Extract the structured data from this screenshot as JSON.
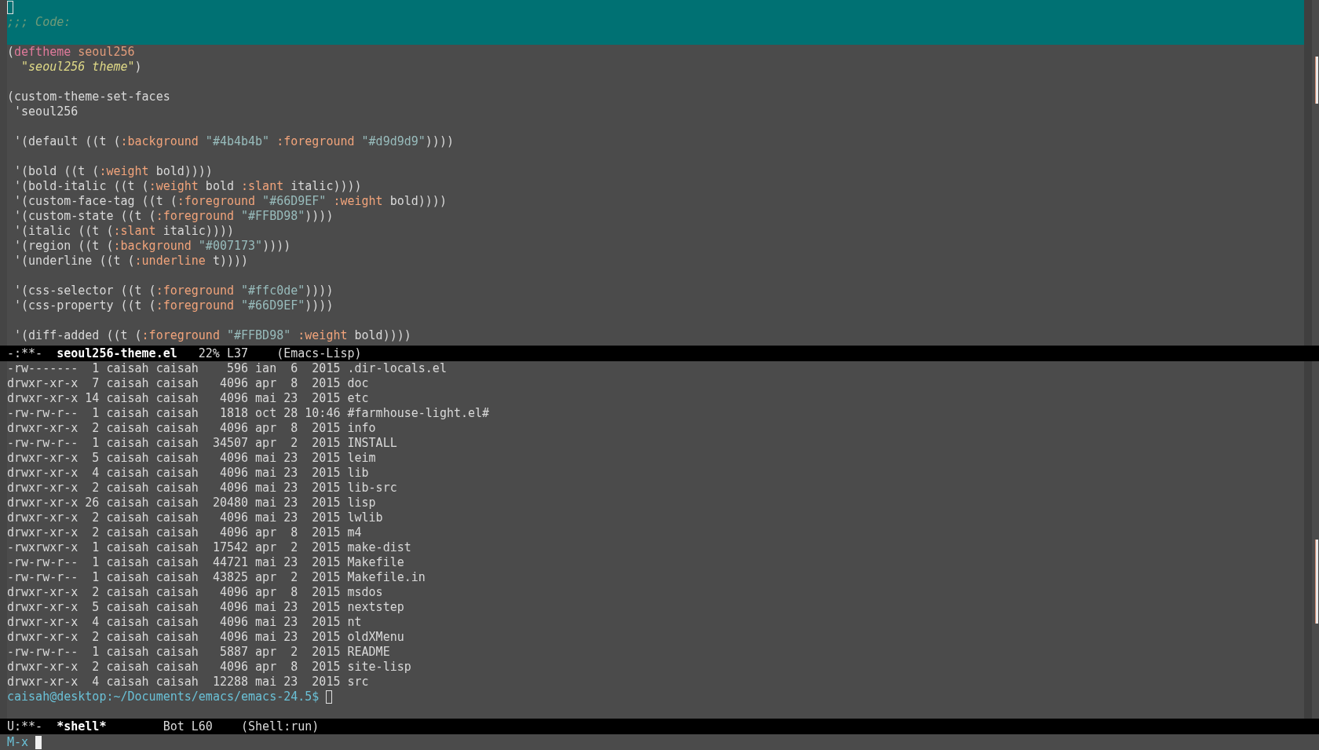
{
  "code_window": {
    "region_lines": [
      {
        "kind": "cursor"
      },
      {
        "kind": "text",
        "tokens": [
          {
            "kind": "comment",
            "text": ";;; Code:"
          }
        ]
      },
      {
        "kind": "blank"
      }
    ],
    "lines": [
      {
        "kind": "text",
        "tokens": [
          "(",
          {
            "kind": "keyword",
            "text": "deftheme"
          },
          {
            "kind": "name",
            "text": " seoul256"
          }
        ]
      },
      {
        "kind": "text",
        "tokens": [
          {
            "kind": "docstring",
            "text": "  \"seoul256 theme\""
          },
          ")"
        ]
      },
      {
        "kind": "blank"
      },
      {
        "kind": "text",
        "tokens": [
          "(custom-theme-set-faces"
        ]
      },
      {
        "kind": "text",
        "tokens": [
          " 'seoul256"
        ]
      },
      {
        "kind": "blank"
      },
      {
        "kind": "text",
        "tokens": [
          " '(default ((t (",
          {
            "kind": "property",
            "text": ":background"
          },
          {
            "kind": "string",
            "text": " \"#4b4b4b\" "
          },
          {
            "kind": "property",
            "text": ":foreground"
          },
          {
            "kind": "string",
            "text": " \"#d9d9d9\""
          },
          "))))"
        ]
      },
      {
        "kind": "blank"
      },
      {
        "kind": "text",
        "tokens": [
          " '(bold ((t (",
          {
            "kind": "property",
            "text": ":weight"
          },
          " bold))))"
        ]
      },
      {
        "kind": "text",
        "tokens": [
          " '(bold-italic ((t (",
          {
            "kind": "property",
            "text": ":weight"
          },
          " bold ",
          {
            "kind": "property",
            "text": ":slant"
          },
          " italic))))"
        ]
      },
      {
        "kind": "text",
        "tokens": [
          " '(custom-face-tag ((t (",
          {
            "kind": "property",
            "text": ":foreground"
          },
          {
            "kind": "string",
            "text": " \"#66D9EF\" "
          },
          {
            "kind": "property",
            "text": ":weight"
          },
          " bold))))"
        ]
      },
      {
        "kind": "text",
        "tokens": [
          " '(custom-state ((t (",
          {
            "kind": "property",
            "text": ":foreground"
          },
          {
            "kind": "string",
            "text": " \"#FFBD98\""
          },
          "))))"
        ]
      },
      {
        "kind": "text",
        "tokens": [
          " '(italic ((t (",
          {
            "kind": "property",
            "text": ":slant"
          },
          " italic))))"
        ]
      },
      {
        "kind": "text",
        "tokens": [
          " '(region ((t (",
          {
            "kind": "property",
            "text": ":background"
          },
          {
            "kind": "string",
            "text": " \"#007173\""
          },
          "))))"
        ]
      },
      {
        "kind": "text",
        "tokens": [
          " '(underline ((t (",
          {
            "kind": "property",
            "text": ":underline"
          },
          " t))))"
        ]
      },
      {
        "kind": "blank"
      },
      {
        "kind": "text",
        "tokens": [
          " '(css-selector ((t (",
          {
            "kind": "property",
            "text": ":foreground"
          },
          {
            "kind": "string",
            "text": " \"#ffc0de\""
          },
          "))))"
        ]
      },
      {
        "kind": "text",
        "tokens": [
          " '(css-property ((t (",
          {
            "kind": "property",
            "text": ":foreground"
          },
          {
            "kind": "string",
            "text": " \"#66D9EF\""
          },
          "))))"
        ]
      },
      {
        "kind": "blank"
      },
      {
        "kind": "text",
        "tokens": [
          " '(diff-added ((t (",
          {
            "kind": "property",
            "text": ":foreground"
          },
          {
            "kind": "string",
            "text": " \"#FFBD98\" "
          },
          {
            "kind": "property",
            "text": ":weight"
          },
          " bold))))"
        ]
      }
    ]
  },
  "code_mode_line": {
    "status": "-:**-",
    "buffer": "seoul256-theme.el",
    "position": "22% L37",
    "mode": "(Emacs-Lisp)"
  },
  "shell_window": {
    "lines": [
      "-rw-------  1 caisah caisah    596 ian  6  2015 .dir-locals.el",
      "drwxr-xr-x  7 caisah caisah   4096 apr  8  2015 doc",
      "drwxr-xr-x 14 caisah caisah   4096 mai 23  2015 etc",
      "-rw-rw-r--  1 caisah caisah   1818 oct 28 10:46 #farmhouse-light.el#",
      "drwxr-xr-x  2 caisah caisah   4096 apr  8  2015 info",
      "-rw-rw-r--  1 caisah caisah  34507 apr  2  2015 INSTALL",
      "drwxr-xr-x  5 caisah caisah   4096 mai 23  2015 leim",
      "drwxr-xr-x  4 caisah caisah   4096 mai 23  2015 lib",
      "drwxr-xr-x  2 caisah caisah   4096 mai 23  2015 lib-src",
      "drwxr-xr-x 26 caisah caisah  20480 mai 23  2015 lisp",
      "drwxr-xr-x  2 caisah caisah   4096 mai 23  2015 lwlib",
      "drwxr-xr-x  2 caisah caisah   4096 apr  8  2015 m4",
      "-rwxrwxr-x  1 caisah caisah  17542 apr  2  2015 make-dist",
      "-rw-rw-r--  1 caisah caisah  44721 mai 23  2015 Makefile",
      "-rw-rw-r--  1 caisah caisah  43825 apr  2  2015 Makefile.in",
      "drwxr-xr-x  2 caisah caisah   4096 apr  8  2015 msdos",
      "drwxr-xr-x  5 caisah caisah   4096 mai 23  2015 nextstep",
      "drwxr-xr-x  4 caisah caisah   4096 mai 23  2015 nt",
      "drwxr-xr-x  2 caisah caisah   4096 mai 23  2015 oldXMenu",
      "-rw-rw-r--  1 caisah caisah   5887 apr  2  2015 README",
      "drwxr-xr-x  2 caisah caisah   4096 apr  8  2015 site-lisp",
      "drwxr-xr-x  4 caisah caisah  12288 mai 23  2015 src"
    ],
    "prompt": "caisah@desktop:~/Documents/emacs/emacs-24.5$"
  },
  "shell_mode_line": {
    "status": "U:**-",
    "buffer": "*shell*",
    "position": "Bot L60",
    "mode": "(Shell:run)"
  },
  "minibuffer": {
    "prompt": "M-x"
  }
}
